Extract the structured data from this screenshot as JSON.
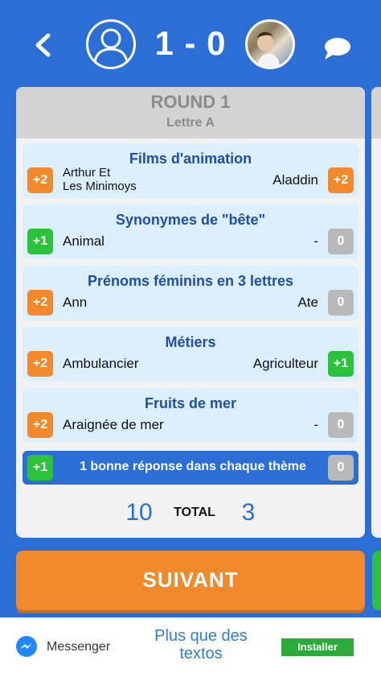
{
  "header": {
    "score": "1 - 0",
    "back_icon": "chevron-left-icon",
    "chat_icon": "chat-bubble-icon",
    "player_left_icon": "user-avatar-icon"
  },
  "round": {
    "title": "ROUND 1",
    "letter": "Lettre A"
  },
  "themes": [
    {
      "title": "Films d'animation",
      "left_answer": "Arthur Et\nLes Minimoys",
      "left_points": "+2",
      "right_answer": "Aladdin",
      "right_points": "+2"
    },
    {
      "title": "Synonymes de \"bête\"",
      "left_answer": "Animal",
      "left_points": "+1",
      "right_answer": "-",
      "right_points": "0"
    },
    {
      "title": "Prénoms féminins en 3 lettres",
      "left_answer": "Ann",
      "left_points": "+2",
      "right_answer": "Ate",
      "right_points": "0"
    },
    {
      "title": "Métiers",
      "left_answer": "Ambulancier",
      "left_points": "+2",
      "right_answer": "Agriculteur",
      "right_points": "+1"
    },
    {
      "title": "Fruits de mer",
      "left_answer": "Araignée de mer",
      "left_points": "+2",
      "right_answer": "-",
      "right_points": "0"
    }
  ],
  "bonus": {
    "text": "1 bonne réponse dans chaque thème",
    "left_points": "+1",
    "right_points": "0"
  },
  "totals": {
    "left": "10",
    "label": "TOTAL",
    "right": "3"
  },
  "next_button": "SUIVANT",
  "ad": {
    "brand": "Messenger",
    "tagline": "Plus que des textos",
    "install": "Installer",
    "icon": "messenger-icon"
  },
  "colors": {
    "background": "#2b6fd6",
    "orange": "#f28a2c",
    "green": "#2cc33a",
    "grey": "#b9b9b9",
    "theme_title": "#1f4fa8"
  }
}
